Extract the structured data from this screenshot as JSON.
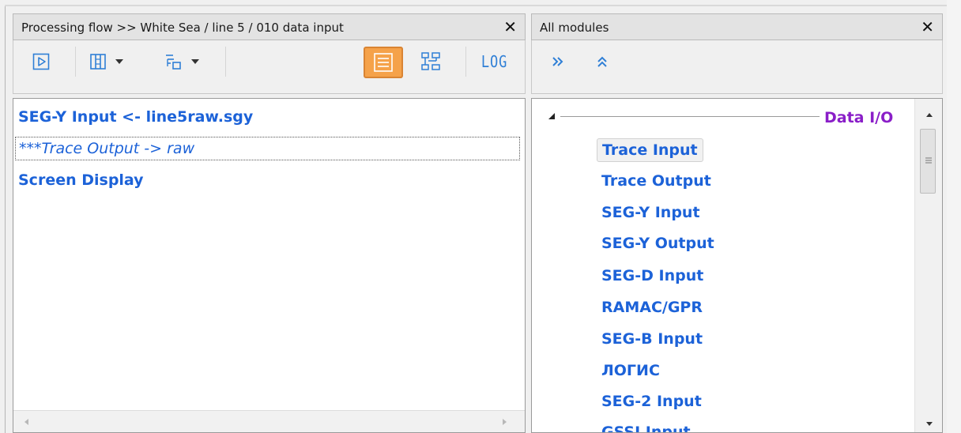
{
  "flow_panel": {
    "title": "Processing flow >> White Sea / line 5 / 010 data input",
    "close_glyph": "✕",
    "items": [
      {
        "label": "SEG-Y Input <- line5raw.sgy",
        "state": "active"
      },
      {
        "label": "***Trace Output -> raw",
        "state": "disabled"
      },
      {
        "label": "Screen Display",
        "state": "active"
      }
    ],
    "toolbar": {
      "log_label": "LOG"
    }
  },
  "modules_panel": {
    "title": "All modules",
    "close_glyph": "✕",
    "category": "Data I/O",
    "items": [
      "Trace Input",
      "Trace Output",
      "SEG-Y Input",
      "SEG-Y Output",
      "SEG-D Input",
      "RAMAC/GPR",
      "SEG-B Input",
      "ЛОГИС",
      "SEG-2 Input",
      "GSSI Input"
    ]
  },
  "colors": {
    "item_text": "#1c62d8",
    "category_text": "#8a1ec8",
    "toggle_active": "#f5a24a"
  },
  "icons": {
    "run": "play-icon",
    "columns": "columns-icon",
    "tree": "tree-icon",
    "list": "list-view-icon",
    "diagram": "diagram-icon",
    "expand_all": "double-chevron-right-icon",
    "collapse_all": "double-chevron-up-icon"
  }
}
